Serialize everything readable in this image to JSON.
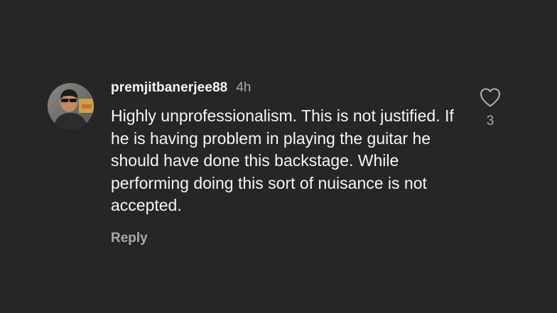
{
  "comment": {
    "username": "premjitbanerjee88",
    "time": "4h",
    "text": "Highly unprofessionalism. This is not justified. If he is having problem in playing the guitar he should have done this backstage. While performing doing this sort of nuisance is not accepted.",
    "reply_label": "Reply",
    "like_count": "3",
    "like_icon": "heart-outline-icon"
  },
  "colors": {
    "background": "#262626",
    "primary_text": "#f5f5f5",
    "secondary_text": "#a8a8a8"
  }
}
